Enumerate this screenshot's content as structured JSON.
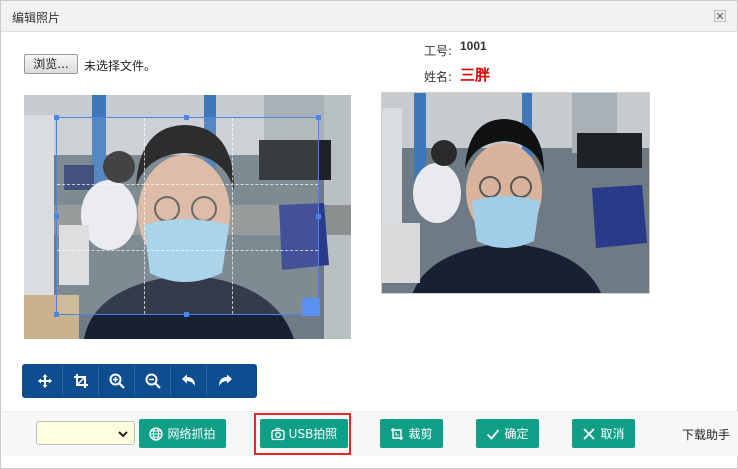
{
  "window": {
    "title": "编辑照片"
  },
  "file": {
    "browse_label": "浏览...",
    "status": "未选择文件。"
  },
  "employee": {
    "id_label": "工号:",
    "id_value": "1001",
    "name_label": "姓名:",
    "name_value": "三胖",
    "name_color": "#e00000"
  },
  "icons": {
    "close": "close-icon",
    "move": "move-icon",
    "crop": "crop-icon",
    "zoom_in": "zoom-in-icon",
    "zoom_out": "zoom-out-icon",
    "rotate_left": "rotate-left-icon",
    "rotate_right": "rotate-right-icon",
    "globe": "globe-icon",
    "camera": "camera-icon",
    "crop_action": "crop-icon",
    "check": "check-icon",
    "cancel": "close-icon"
  },
  "colors": {
    "toolbar_bg": "#0e4d8f",
    "action_button": "#0f9e86",
    "highlight_border": "#e12a2a",
    "select_bg": "#ffffe0"
  },
  "actions": {
    "network_capture": "网络抓拍",
    "usb_capture": "USB拍照",
    "crop": "裁剪",
    "confirm": "确定",
    "cancel": "取消"
  },
  "source_select": {
    "selected": ""
  },
  "helper_link": "下载助手"
}
